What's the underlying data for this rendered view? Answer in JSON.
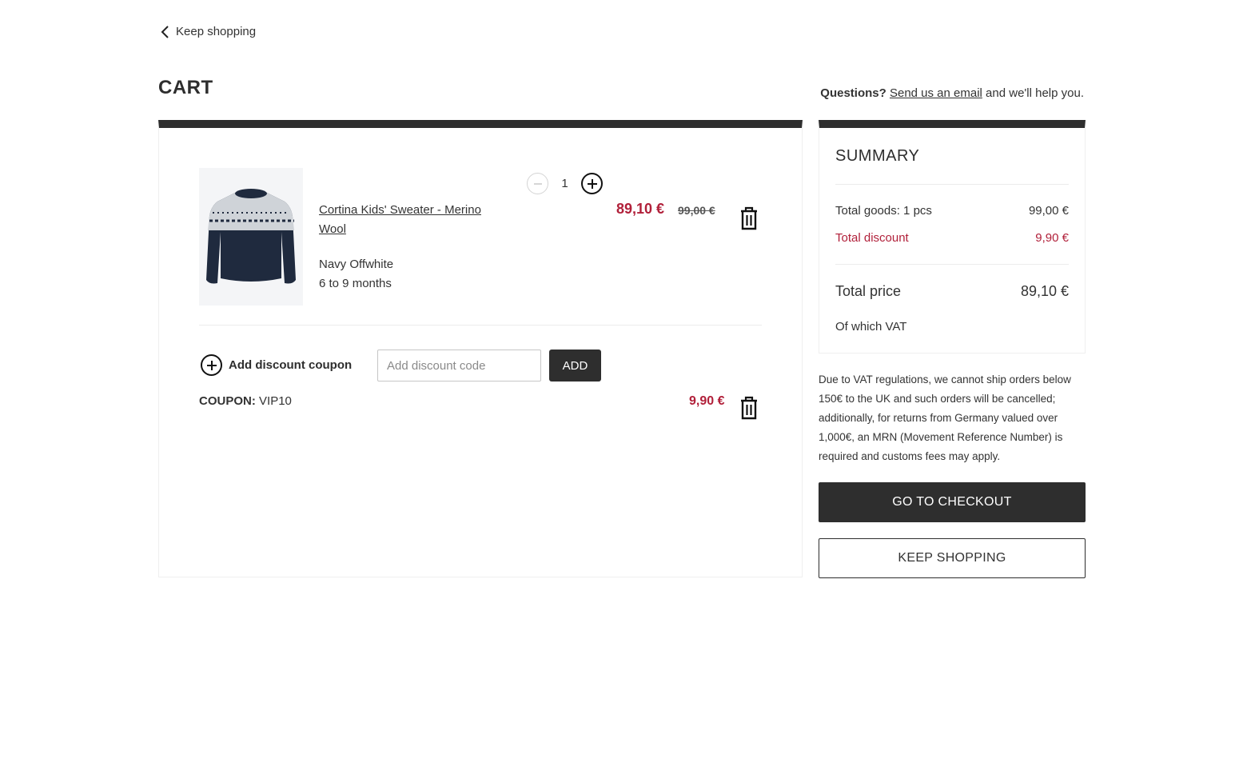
{
  "nav": {
    "back_label": "Keep shopping"
  },
  "page": {
    "title": "CART"
  },
  "help": {
    "prefix": "Questions?",
    "link_label": "Send us an email",
    "suffix": "and we'll help you."
  },
  "item": {
    "name": "Cortina Kids' Sweater - Merino Wool",
    "color": "Navy Offwhite",
    "size": "6 to 9 months",
    "quantity": "1",
    "price": "89,10 €",
    "original_price": "99,00 €",
    "image_icon": "sweater-icon"
  },
  "coupon": {
    "add_label": "Add discount coupon",
    "input_placeholder": "Add discount code",
    "add_button": "ADD",
    "applied_label": "COUPON:",
    "applied_code": "VIP10",
    "applied_amount": "9,90 €"
  },
  "summary": {
    "title": "SUMMARY",
    "total_goods_label": "Total goods: 1 pcs",
    "total_goods_value": "99,00 €",
    "discount_label": "Total discount",
    "discount_value": "9,90 €",
    "total_price_label": "Total price",
    "total_price_value": "89,10 €",
    "vat_label": "Of which VAT"
  },
  "vat_note": "Due to VAT regulations, we cannot ship orders below 150€ to the UK and such orders will be cancelled; additionally, for returns from Germany valued over 1,000€, an MRN (Movement Reference Number) is required and customs fees may apply.",
  "actions": {
    "checkout": "GO TO CHECKOUT",
    "keep_shopping": "KEEP SHOPPING"
  },
  "colors": {
    "accent_red": "#b1203a",
    "dark": "#2e2e2e",
    "border": "#efefef"
  }
}
